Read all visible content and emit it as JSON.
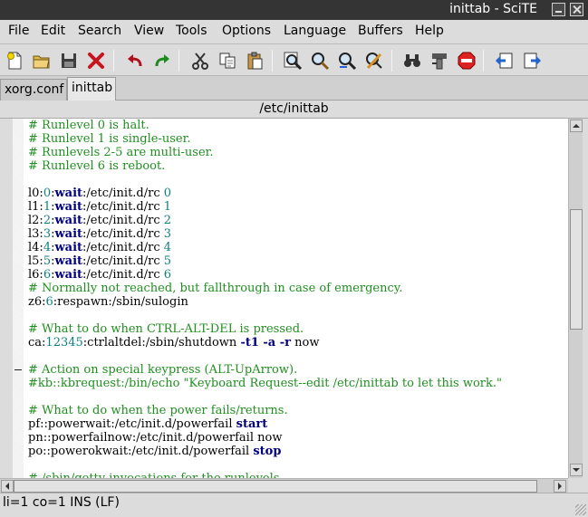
{
  "window": {
    "title": "inittab - SciTE"
  },
  "menu": [
    "File",
    "Edit",
    "Search",
    "View",
    "Tools",
    "Options",
    "Language",
    "Buffers",
    "Help"
  ],
  "toolbar": {
    "icons": [
      "new-file-icon",
      "open-folder-icon",
      "save-disk-icon",
      "close-x-icon",
      "undo-icon",
      "redo-icon",
      "cut-icon",
      "copy-icon",
      "paste-icon",
      "find-icon",
      "find-next-icon",
      "replace-icon",
      "find-in-files-icon",
      "compile-icon",
      "build-icon",
      "stop-icon",
      "previous-buffer-icon",
      "next-buffer-icon"
    ]
  },
  "tabs": [
    {
      "label": "xorg.conf",
      "active": false
    },
    {
      "label": "inittab",
      "active": true
    }
  ],
  "path": "/etc/inittab",
  "editor": {
    "lines": [
      [
        [
          "c",
          "# Runlevel 0 is halt."
        ]
      ],
      [
        [
          "c",
          "# Runlevel 1 is single-user."
        ]
      ],
      [
        [
          "c",
          "# Runlevels 2-5 are multi-user."
        ]
      ],
      [
        [
          "c",
          "# Runlevel 6 is reboot."
        ]
      ],
      [],
      [
        [
          "t",
          "l0:"
        ],
        [
          "n",
          "0"
        ],
        [
          "t",
          ":"
        ],
        [
          "k",
          "wait"
        ],
        [
          "t",
          ":/etc/init.d/rc "
        ],
        [
          "n",
          "0"
        ]
      ],
      [
        [
          "t",
          "l1:"
        ],
        [
          "n",
          "1"
        ],
        [
          "t",
          ":"
        ],
        [
          "k",
          "wait"
        ],
        [
          "t",
          ":/etc/init.d/rc "
        ],
        [
          "n",
          "1"
        ]
      ],
      [
        [
          "t",
          "l2:"
        ],
        [
          "n",
          "2"
        ],
        [
          "t",
          ":"
        ],
        [
          "k",
          "wait"
        ],
        [
          "t",
          ":/etc/init.d/rc "
        ],
        [
          "n",
          "2"
        ]
      ],
      [
        [
          "t",
          "l3:"
        ],
        [
          "n",
          "3"
        ],
        [
          "t",
          ":"
        ],
        [
          "k",
          "wait"
        ],
        [
          "t",
          ":/etc/init.d/rc "
        ],
        [
          "n",
          "3"
        ]
      ],
      [
        [
          "t",
          "l4:"
        ],
        [
          "n",
          "4"
        ],
        [
          "t",
          ":"
        ],
        [
          "k",
          "wait"
        ],
        [
          "t",
          ":/etc/init.d/rc "
        ],
        [
          "n",
          "4"
        ]
      ],
      [
        [
          "t",
          "l5:"
        ],
        [
          "n",
          "5"
        ],
        [
          "t",
          ":"
        ],
        [
          "k",
          "wait"
        ],
        [
          "t",
          ":/etc/init.d/rc "
        ],
        [
          "n",
          "5"
        ]
      ],
      [
        [
          "t",
          "l6:"
        ],
        [
          "n",
          "6"
        ],
        [
          "t",
          ":"
        ],
        [
          "k",
          "wait"
        ],
        [
          "t",
          ":/etc/init.d/rc "
        ],
        [
          "n",
          "6"
        ]
      ],
      [
        [
          "c",
          "# Normally not reached, but fallthrough in case of emergency."
        ]
      ],
      [
        [
          "t",
          "z6:"
        ],
        [
          "n",
          "6"
        ],
        [
          "t",
          ":respawn:/sbin/sulogin"
        ]
      ],
      [],
      [
        [
          "c",
          "# What to do when CTRL-ALT-DEL is pressed."
        ]
      ],
      [
        [
          "t",
          "ca:"
        ],
        [
          "n",
          "12345"
        ],
        [
          "t",
          ":ctrlaltdel:/sbin/shutdown "
        ],
        [
          "k",
          "-t1 -a -r"
        ],
        [
          "t",
          " now"
        ]
      ],
      [],
      [
        [
          "c",
          "# Action on special keypress (ALT-UpArrow)."
        ]
      ],
      [
        [
          "c",
          "#kb::kbrequest:/bin/echo \"Keyboard Request--edit /etc/inittab to let this work.\""
        ]
      ],
      [],
      [
        [
          "c",
          "# What to do when the power fails/returns."
        ]
      ],
      [
        [
          "t",
          "pf::powerwait:/etc/init.d/powerfail "
        ],
        [
          "k",
          "start"
        ]
      ],
      [
        [
          "t",
          "pn::powerfailnow:/etc/init.d/powerfail now"
        ]
      ],
      [
        [
          "t",
          "po::powerokwait:/etc/init.d/powerfail "
        ],
        [
          "k",
          "stop"
        ]
      ],
      [],
      [
        [
          "c",
          "# /sbin/getty invocations for the runlevels."
        ]
      ]
    ]
  },
  "status": "li=1 co=1 INS (LF)"
}
